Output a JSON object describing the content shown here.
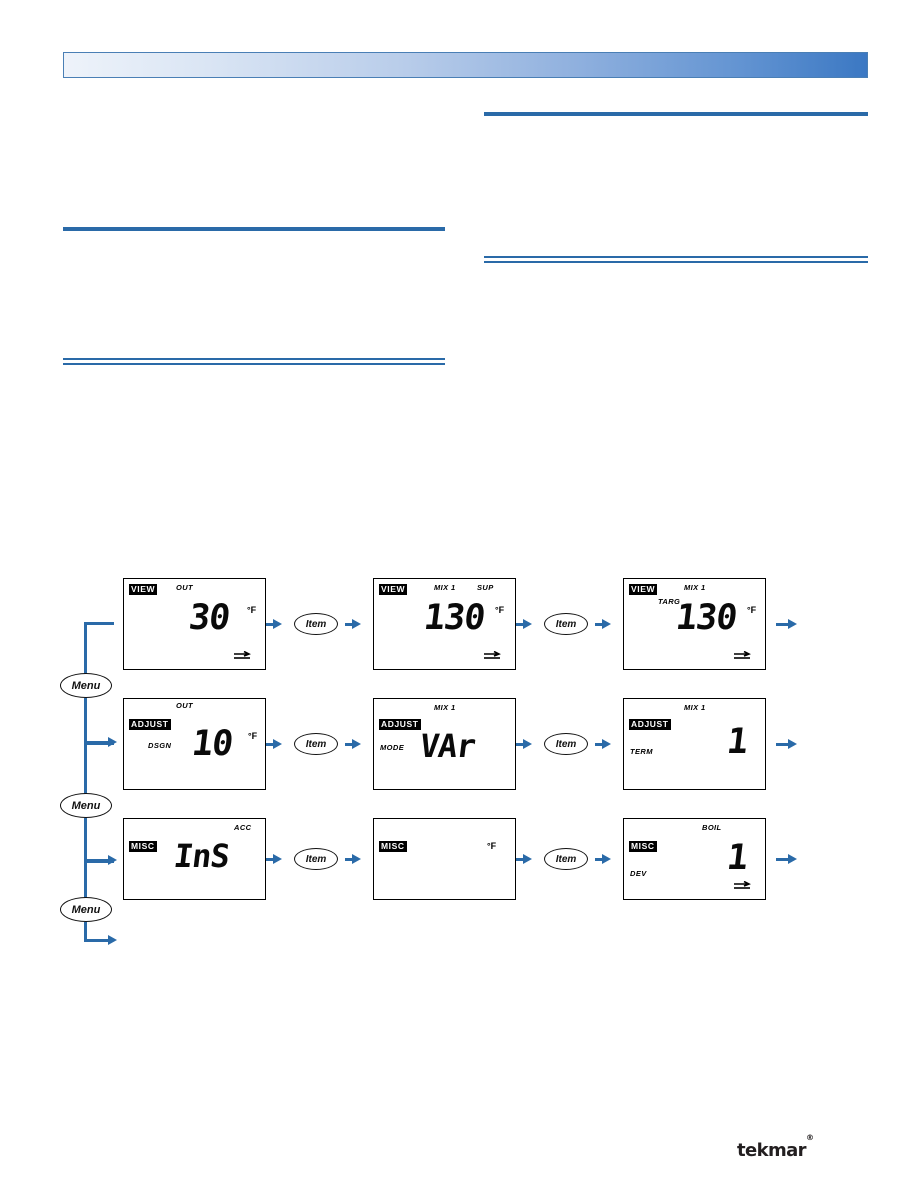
{
  "header": {
    "bar_gradient_from": "#eef3fa",
    "bar_gradient_to": "#3b78c3",
    "accent_color": "#2a6aa8"
  },
  "brand": {
    "name": "tekmar",
    "trademark": "®"
  },
  "navigation": {
    "menu_label": "Menu",
    "item_label": "Item"
  },
  "diagram": {
    "rows": [
      {
        "menu": "Menu",
        "screens": [
          {
            "mode": "VIEW",
            "top_label": "OUT",
            "secondary_label": "",
            "corner_label": "",
            "value": "30",
            "unit": "°F",
            "flow_icon": "flow-icon"
          },
          {
            "mode": "VIEW",
            "top_label": "MIX 1",
            "secondary_label": "",
            "corner_label": "SUP",
            "value": "130",
            "unit": "°F",
            "flow_icon": "flow-icon"
          },
          {
            "mode": "VIEW",
            "top_label": "MIX 1",
            "secondary_label": "TARG",
            "corner_label": "",
            "value": "130",
            "unit": "°F",
            "flow_icon": "flow-icon"
          }
        ]
      },
      {
        "menu": "Menu",
        "screens": [
          {
            "mode": "ADJUST",
            "top_label": "OUT",
            "secondary_label": "DSGN",
            "corner_label": "",
            "value": "10",
            "unit": "°F",
            "flow_icon": ""
          },
          {
            "mode": "ADJUST",
            "top_label": "MIX 1",
            "secondary_label": "MODE",
            "corner_label": "",
            "value": "VAr",
            "unit": "",
            "flow_icon": ""
          },
          {
            "mode": "ADJUST",
            "top_label": "MIX 1",
            "secondary_label": "TERM",
            "corner_label": "",
            "value": "1",
            "unit": "",
            "flow_icon": ""
          }
        ]
      },
      {
        "menu": "Menu",
        "screens": [
          {
            "mode": "MISC",
            "top_label": "",
            "secondary_label": "",
            "corner_label": "ACC",
            "value": "InS",
            "unit": "",
            "flow_icon": ""
          },
          {
            "mode": "MISC",
            "top_label": "",
            "secondary_label": "",
            "corner_label": "",
            "value": "",
            "unit": "°F",
            "flow_icon": ""
          },
          {
            "mode": "MISC",
            "top_label": "BOIL",
            "secondary_label": "DEV",
            "corner_label": "",
            "value": "1",
            "unit": "",
            "flow_icon": "flow-icon"
          }
        ]
      }
    ]
  }
}
